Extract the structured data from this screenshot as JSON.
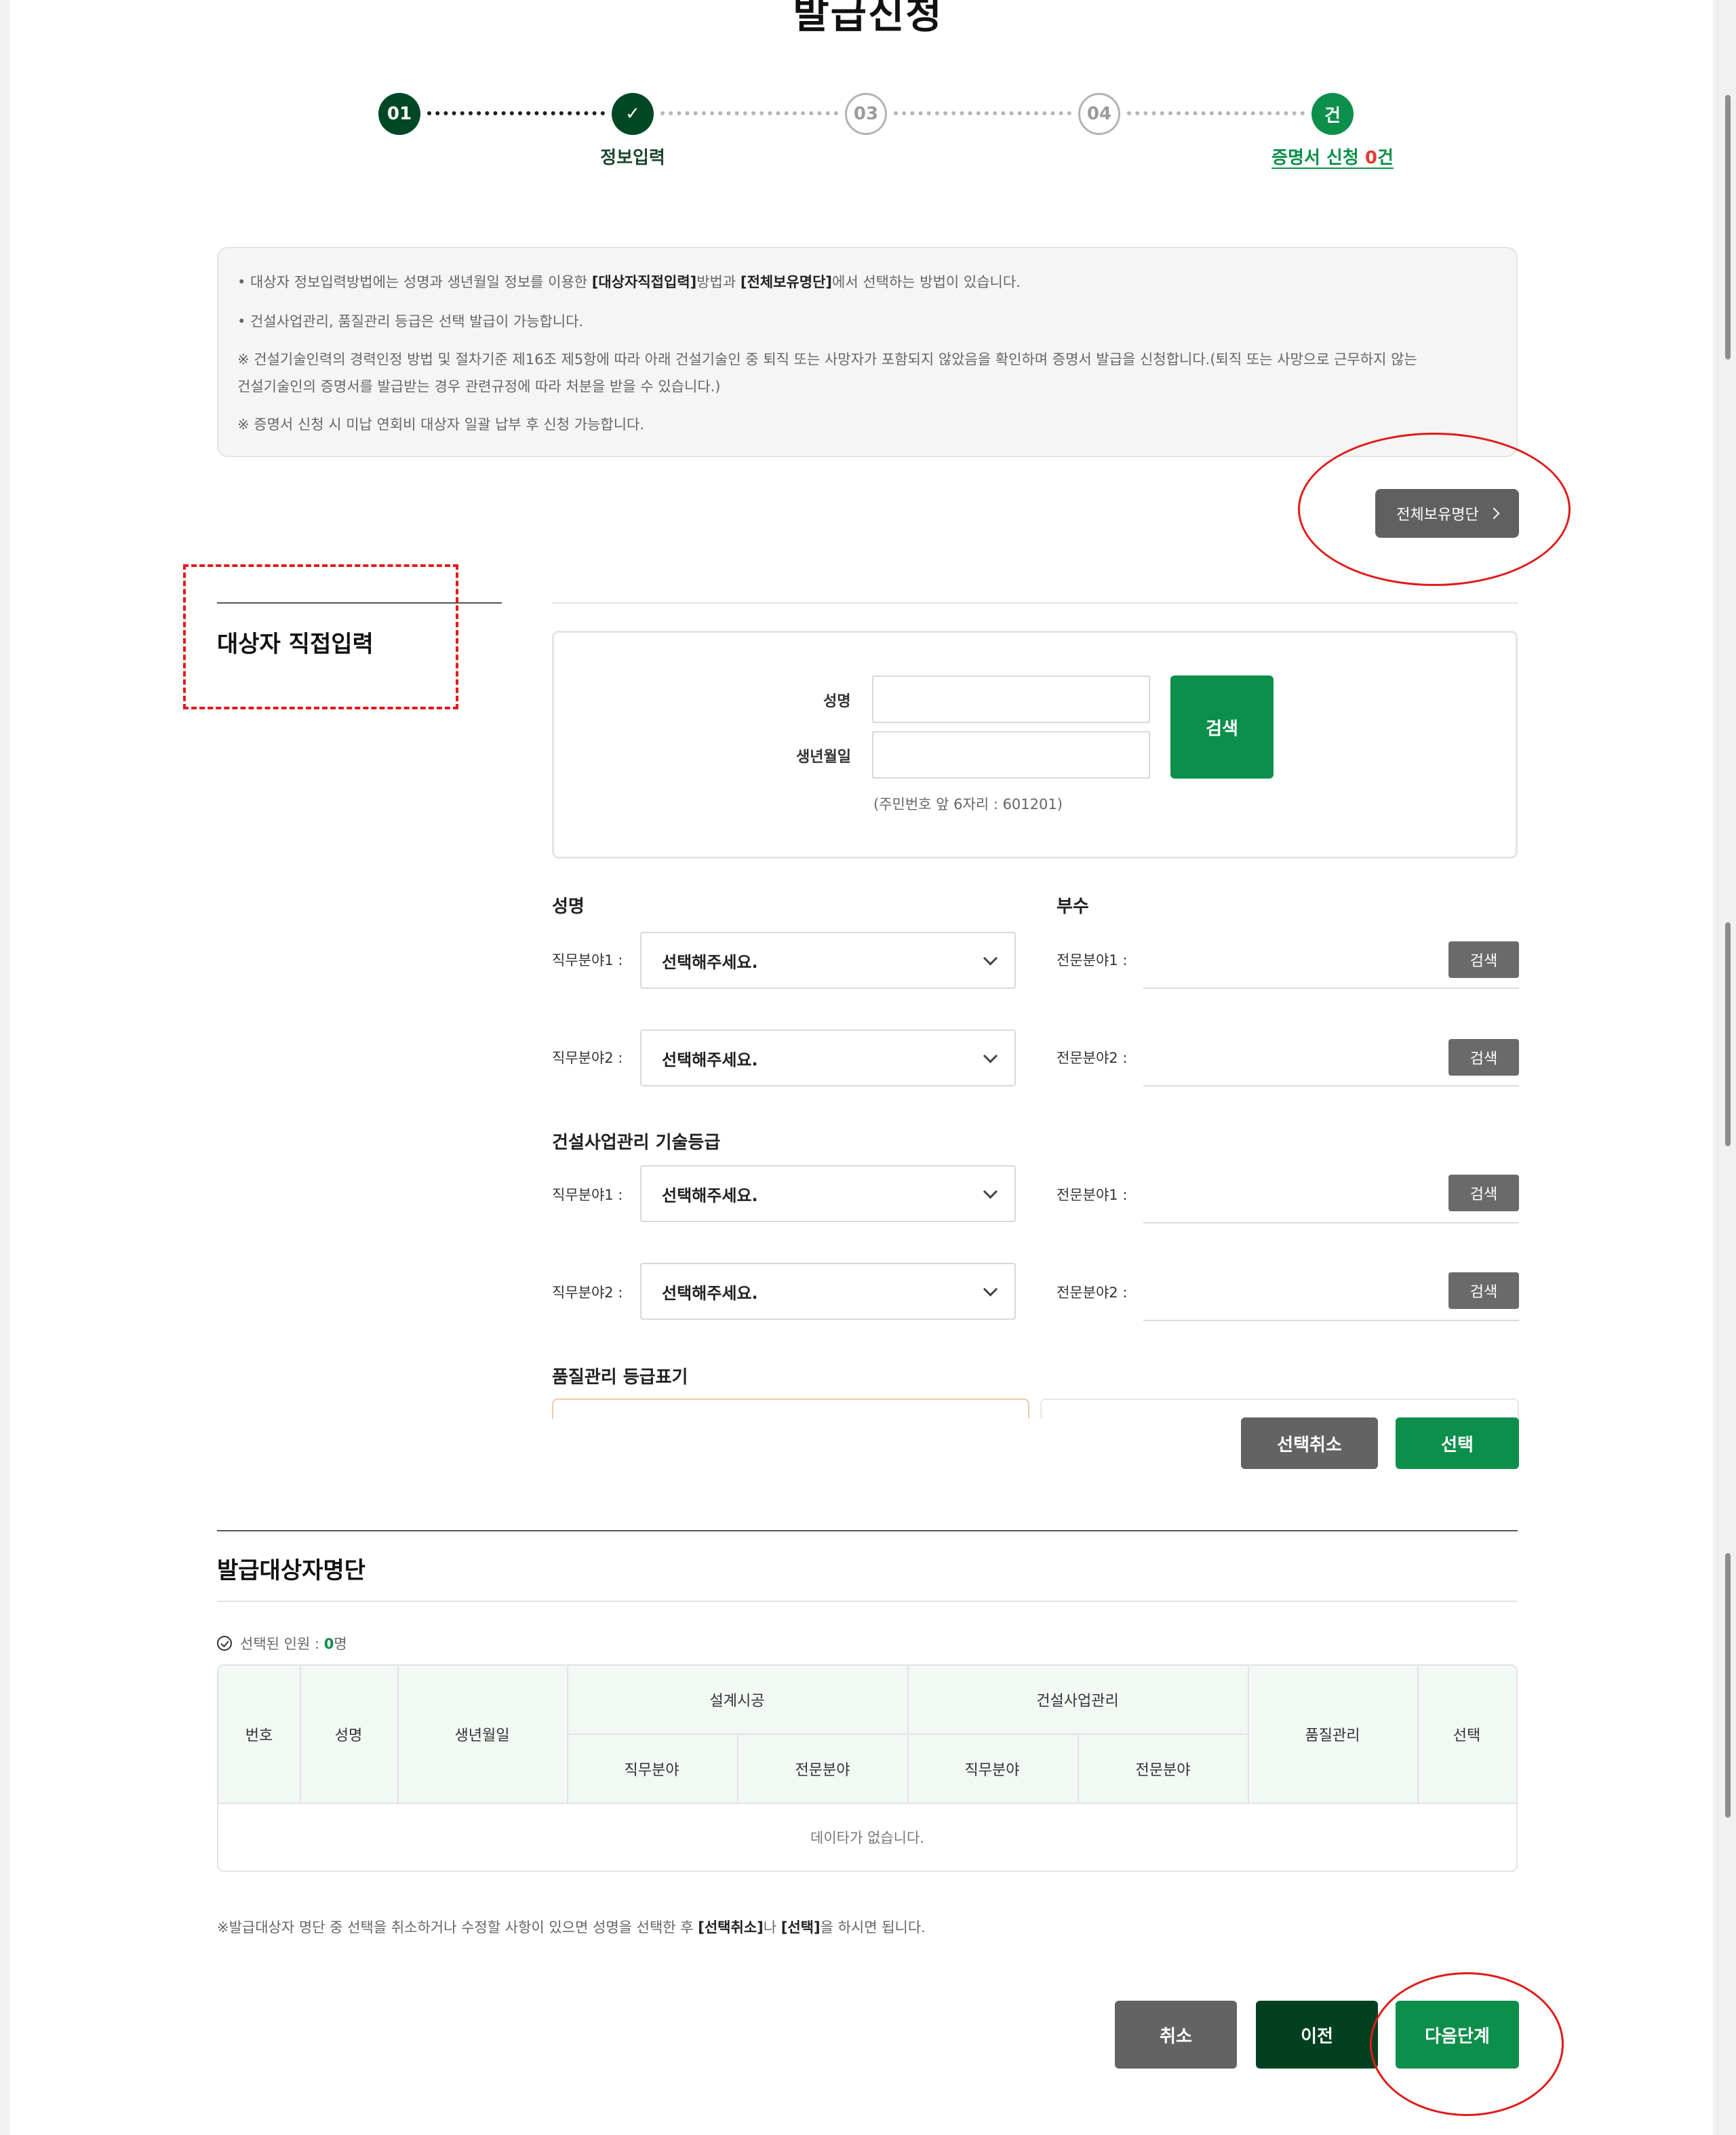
{
  "page": {
    "title": "발급신청"
  },
  "stepper": {
    "steps": [
      {
        "label": "01",
        "state": "done"
      },
      {
        "label": "✓",
        "caption": "정보입력",
        "state": "done"
      },
      {
        "label": "03",
        "state": "todo"
      },
      {
        "label": "04",
        "state": "todo"
      },
      {
        "label": "건",
        "state": "current"
      }
    ],
    "cert_count_prefix": "증명서 신청 ",
    "cert_count_value": "0",
    "cert_count_suffix": "건"
  },
  "notice": {
    "line1_a": "• 대상자 정보입력방법에는 성명과 생년월일 정보를 이용한 ",
    "line1_b": "[대상자직접입력]",
    "line1_c": "방법과 ",
    "line1_d": "[전체보유명단]",
    "line1_e": "에서 선택하는 방법이 있습니다.",
    "line2": "• 건설사업관리, 품질관리 등급은 선택 발급이 가능합니다.",
    "line3": "※ 건설기술인력의 경력인정 방법 및 절차기준 제16조 제5항에 따라 아래 건설기술인 중 퇴직 또는 사망자가 포함되지 않았음을 확인하며 증명서 발급을 신청합니다.(퇴직 또는 사망으로 근무하지 않는",
    "line4": "건설기술인의 증명서를 발급받는 경우 관련규정에 따라 처분을 받을 수 있습니다.)",
    "line5": "※ 증명서 신청 시 미납 연회비 대상자 일괄 납부 후 신청 가능합니다."
  },
  "full_list_button": "전체보유명단",
  "direct_input": {
    "title": "대상자 직접입력",
    "name_label": "성명",
    "birth_label": "생년월일",
    "name_value": "",
    "birth_value": "",
    "search_button": "검색",
    "hint": "(주민번호 앞 6자리 : 601201)"
  },
  "design_group": {
    "name_title": "성명",
    "dept_title": "부수",
    "job1_label": "직무분야1 :",
    "job2_label": "직무분야2 :",
    "spec1_label": "전문분야1 :",
    "spec2_label": "전문분야2 :",
    "select_placeholder": "선택해주세요.",
    "search_button": "검색"
  },
  "cm_group": {
    "title": "건설사업관리 기술등급",
    "job1_label": "직무분야1 :",
    "job2_label": "직무분야2 :",
    "spec1_label": "전문분야1 :",
    "spec2_label": "전문분야2 :",
    "select_placeholder": "선택해주세요.",
    "search_button": "검색"
  },
  "quality_group": {
    "title": "품질관리 등급표기"
  },
  "selection_buttons": {
    "cancel": "선택취소",
    "select": "선택"
  },
  "target_list": {
    "title": "발급대상자명단",
    "selected_prefix": "선택된 인원 : ",
    "selected_count": "0",
    "selected_suffix": "명",
    "columns": {
      "no": "번호",
      "name": "성명",
      "birth": "생년월일",
      "design": "설계시공",
      "cm": "건설사업관리",
      "job": "직무분야",
      "spec": "전문분야",
      "quality": "품질관리",
      "select": "선택"
    },
    "empty_text": "데이타가 없습니다.",
    "note_a": "※발급대상자 명단 중 선택을 취소하거나 수정할 사항이 있으면 성명을 선택한 후 ",
    "note_b": "[선택취소]",
    "note_c": "나 ",
    "note_d": "[선택]",
    "note_e": "을 하시면 됩니다."
  },
  "footer_buttons": {
    "cancel": "취소",
    "prev": "이전",
    "next": "다음단계"
  },
  "colors": {
    "brand_green": "#0c8f4a",
    "dark_green": "#004825",
    "annotation_red": "#e01b1b"
  }
}
